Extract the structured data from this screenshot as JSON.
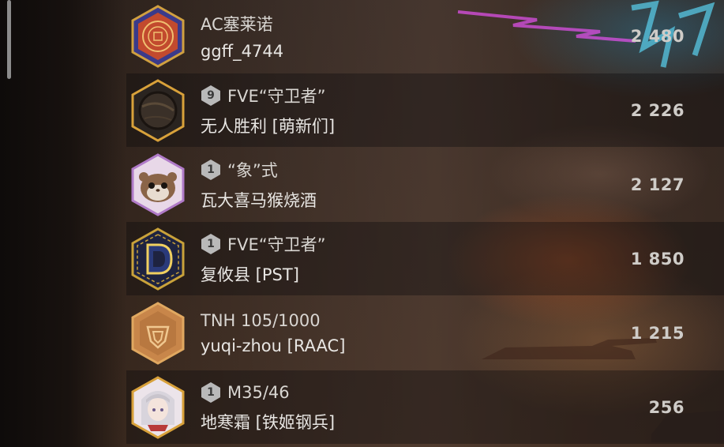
{
  "leaderboard": [
    {
      "title": "AC塞莱诺",
      "player": "ggff_4744",
      "score": "2 480",
      "level": "",
      "emblem": "red-seal-emblem"
    },
    {
      "title": "FVE“守卫者”",
      "player": "无人胜利 [萌新们]",
      "score": "2 226",
      "level": "9",
      "emblem": "planet-emblem"
    },
    {
      "title": "“象”式",
      "player": "瓦大喜马猴烧酒",
      "score": "2 127",
      "level": "1",
      "emblem": "hamster-emblem"
    },
    {
      "title": "FVE“守卫者”",
      "player": "复攸县 [PST]",
      "score": "1 850",
      "level": "1",
      "emblem": "letter-d-emblem"
    },
    {
      "title": "TNH 105/1000",
      "player": "yuqi-zhou [RAAC]",
      "score": "1 215",
      "level": "",
      "emblem": "bronze-shield-emblem"
    },
    {
      "title": "M35/46",
      "player": "地寒霜 [铁姬钢兵]",
      "score": "256",
      "level": "1",
      "emblem": "anime-girl-emblem"
    }
  ],
  "colors": {
    "hex_gold": "#d8a13a",
    "hex_purple": "#b07ac8",
    "hex_blue_gold": "#c9a23a",
    "badge_silver": "#b9b9b9"
  }
}
